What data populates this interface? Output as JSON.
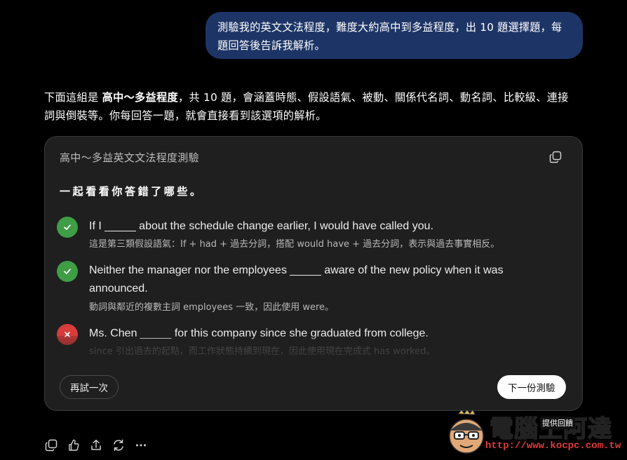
{
  "user_message": {
    "line1": "測驗我的英文文法程度，難度大約高中到多益程度，出 10 題選擇題，每",
    "line2": "題回答後告訴我解析。"
  },
  "assistant_intro": {
    "part1": "下面這組是 ",
    "bold": "高中～多益程度",
    "part2": "，共 10 題，會涵蓋時態、假設語氣、被動、關係代名詞、動名詞、比較級、連接",
    "line2": "詞與倒裝等。你每回答一題，就會直接看到該選項的解析。"
  },
  "quiz_card": {
    "title": "高中～多益英文文法程度測驗",
    "copy_icon": "copy-icon",
    "section_heading": "一起看看你答錯了哪些。",
    "results": [
      {
        "status": "correct",
        "icon": "check-icon",
        "question": "If I _____ about the schedule change earlier, I would have called you.",
        "explanation": "這是第三類假設語氣：If + had + 過去分詞，搭配 would have + 過去分詞，表示與過去事實相反。"
      },
      {
        "status": "correct",
        "icon": "check-icon",
        "question": "Neither the manager nor the employees _____ aware of the new policy when it was announced.",
        "explanation": "動詞與鄰近的複數主詞 employees 一致，因此使用 were。"
      },
      {
        "status": "wrong",
        "icon": "cross-icon",
        "question": "Ms. Chen _____ for this company since she graduated from college.",
        "explanation": "since 引出過去的起點，而工作狀態持續到現在，因此使用現在完成式 has worked。"
      }
    ],
    "retry_label": "再試一次",
    "next_label": "下一份測驗"
  },
  "action_bar": {
    "icons": [
      "copy-icon",
      "feedback-icon",
      "share-icon",
      "regenerate-icon",
      "more-icon"
    ]
  },
  "tooltip": "提供回饋",
  "watermark": {
    "name": "電腦王阿達",
    "url": "http://www.kocpc.com.tw"
  },
  "colors": {
    "background": "#000000",
    "user_bubble": "#1d3566",
    "card": "#1f1f1f",
    "correct": "#3f9d46",
    "wrong": "#d83c3c"
  }
}
